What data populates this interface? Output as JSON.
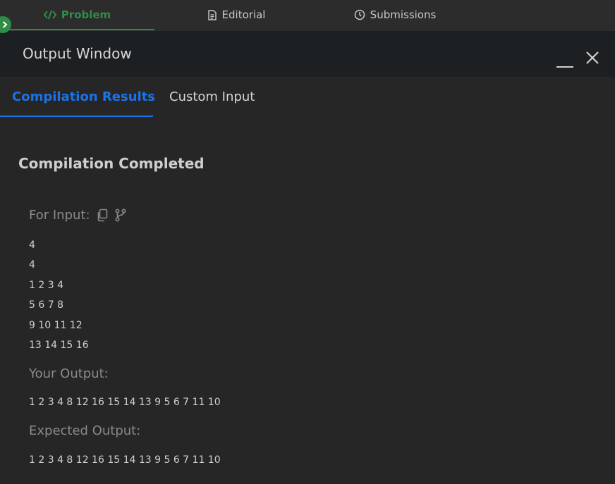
{
  "top_tabs": [
    {
      "label": "Problem",
      "icon": "code-icon",
      "active": true
    },
    {
      "label": "Editorial",
      "icon": "document-icon",
      "active": false
    },
    {
      "label": "Submissions",
      "icon": "clock-icon",
      "active": false
    }
  ],
  "window": {
    "title": "Output Window"
  },
  "result_tabs": [
    {
      "label": "Compilation Results",
      "active": true
    },
    {
      "label": "Custom Input",
      "active": false
    }
  ],
  "result": {
    "status": "Compilation Completed",
    "for_input_label": "For Input:",
    "input_lines": [
      "4",
      "4",
      "1 2 3 4",
      "5 6 7 8",
      "9 10 11 12",
      "13 14 15 16"
    ],
    "your_output_label": "Your Output:",
    "your_output": "1 2 3 4 8 12 16 15 14 13 9 5 6 7 11 10",
    "expected_output_label": "Expected Output:",
    "expected_output": "1 2 3 4 8 12 16 15 14 13 9 5 6 7 11 10"
  },
  "colors": {
    "accent_green": "#2f8d46",
    "accent_blue": "#1a73e8",
    "background": "#262626",
    "header_background": "#1d2022"
  }
}
